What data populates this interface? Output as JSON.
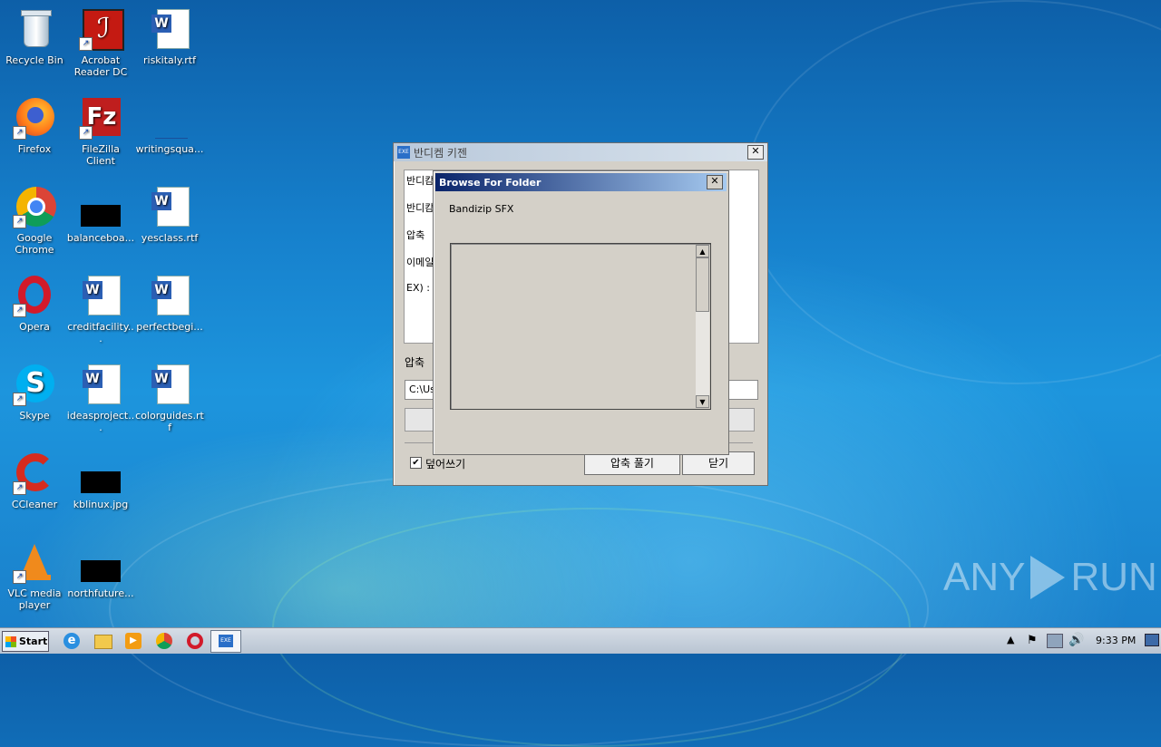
{
  "desktop_icons": [
    {
      "label": "Recycle Bin"
    },
    {
      "label": "Acrobat Reader DC"
    },
    {
      "label": "riskitaly.rtf"
    },
    {
      "label": "Firefox"
    },
    {
      "label": "FileZilla Client"
    },
    {
      "label": "writingsqua..."
    },
    {
      "label": "Google Chrome"
    },
    {
      "label": "balanceboa..."
    },
    {
      "label": "yesclass.rtf"
    },
    {
      "label": "Opera"
    },
    {
      "label": "creditfacility..."
    },
    {
      "label": "perfectbegi..."
    },
    {
      "label": "Skype"
    },
    {
      "label": "ideasproject..."
    },
    {
      "label": "colorguides.rtf"
    },
    {
      "label": "CCleaner"
    },
    {
      "label": "kblinux.jpg"
    },
    {
      "label": "VLC media player"
    },
    {
      "label": "northfuture..."
    }
  ],
  "main_window": {
    "title": "반디켐 키젠",
    "text_lines": [
      "반디캄",
      "반디캄",
      "압축 ",
      "이메일",
      "EX) :"
    ],
    "path_label": "압축 ",
    "path_value": "C:\\Us",
    "overwrite_label": "덮어쓰기",
    "extract_button": "압축 풀기",
    "close_button": "닫기"
  },
  "browse_dialog": {
    "title": "Browse For Folder",
    "description": "Bandizip SFX"
  },
  "taskbar": {
    "start_label": "Start",
    "time": "9:33 PM"
  },
  "watermark": {
    "text_left": "ANY",
    "text_right": "RUN"
  }
}
